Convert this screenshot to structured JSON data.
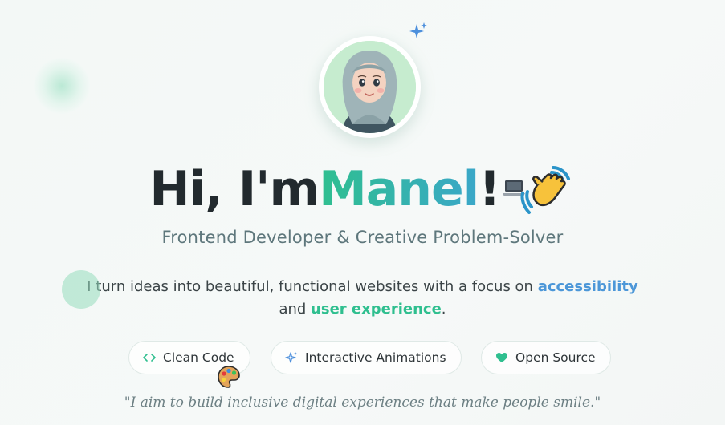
{
  "hero": {
    "greeting_prefix": "Hi, I'm ",
    "name": "Manel",
    "greeting_suffix": "!",
    "subtitle": "Frontend Developer & Creative Problem-Solver",
    "description_part1": "I turn ideas into beautiful, functional websites with a focus on ",
    "description_highlight1": "accessibility",
    "description_part2": " and ",
    "description_highlight2": "user experience",
    "description_part3": ".",
    "quote": "\"I aim to build inclusive digital experiences that make people smile.\""
  },
  "chips": [
    {
      "label": "Clean Code",
      "icon": "code-brackets-icon"
    },
    {
      "label": "Interactive Animations",
      "icon": "sparkle-icon"
    },
    {
      "label": "Open Source",
      "icon": "heart-icon"
    }
  ],
  "icons": {
    "avatar": "avatar-hijab-illustration",
    "headline_emojis": [
      "laptop-icon",
      "waving-hand-icon"
    ],
    "floating": [
      "sparkle-icon",
      "palette-icon"
    ]
  },
  "colors": {
    "accent_green": "#2fbf8f",
    "accent_blue": "#4c97d8",
    "text_dark": "#222a2e",
    "subtitle": "#5e777c"
  }
}
